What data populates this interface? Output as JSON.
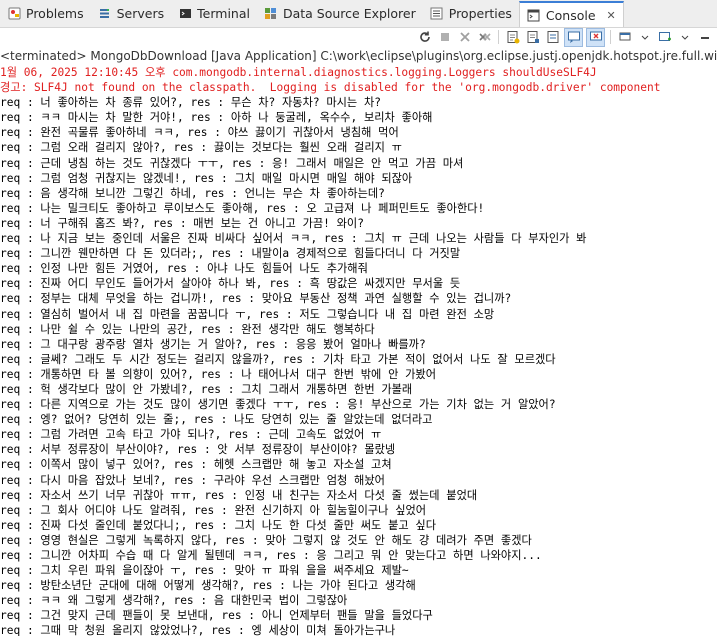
{
  "tabs": [
    {
      "label": "Problems",
      "icon": "problems-icon",
      "active": false
    },
    {
      "label": "Servers",
      "icon": "servers-icon",
      "active": false
    },
    {
      "label": "Terminal",
      "icon": "terminal-icon",
      "active": false
    },
    {
      "label": "Data Source Explorer",
      "icon": "data-source-explorer-icon",
      "active": false
    },
    {
      "label": "Properties",
      "icon": "properties-icon",
      "active": false
    },
    {
      "label": "Console",
      "icon": "console-icon",
      "active": true,
      "close": "✕"
    }
  ],
  "launch_label": "<terminated> MongoDbDownload [Java Application] C:\\work\\eclipse\\plugins\\org.eclipse.justj.openjdk.hotspot.jre.full.win32.x86_64",
  "console_lines": [
    {
      "text": "1월 06, 2025 12:10:45 오후 com.mongodb.internal.diagnostics.logging.Loggers shouldUseSLF4J",
      "style": "err"
    },
    {
      "text": "경고: SLF4J not found on the classpath.  Logging is disabled for the 'org.mongodb.driver' component",
      "style": "err"
    },
    {
      "text": "req : 너 좋아하는 차 종류 있어?, res : 무슨 차? 자동차? 마시는 차?",
      "style": "out"
    },
    {
      "text": "req : ㅋㅋ 마시는 차 말한 거야!, res : 아하 나 둥굴레, 옥수수, 보리차 좋아해",
      "style": "out"
    },
    {
      "text": "req : 완전 곡물류 좋아하네 ㅋㅋ, res : 야쓰 끓이기 귀찮아서 냉침해 먹어",
      "style": "out"
    },
    {
      "text": "req : 그럼 오래 걸리지 않아?, res : 끓이는 것보다는 훨씬 오래 걸리지 ㅠ",
      "style": "out"
    },
    {
      "text": "req : 근데 냉침 하는 것도 귀찮겠다 ㅜㅜ, res : 응! 그래서 매일은 안 먹고 가끔 마셔",
      "style": "out"
    },
    {
      "text": "req : 그럼 엄청 귀찮지는 않겠네!, res : 그치 매일 마시면 매일 해야 되잖아",
      "style": "out"
    },
    {
      "text": "req : 음 생각해 보니깐 그렇긴 하네, res : 언니는 무슨 차 좋아하는데?",
      "style": "out"
    },
    {
      "text": "req : 나는 밀크티도 좋아하고 루이보스도 좋아해, res : 오 고급져 나 페퍼민트도 좋아한다!",
      "style": "out"
    },
    {
      "text": "req : 너 구해줘 홈즈 봐?, res : 매번 보는 건 아니고 가끔! 와이?",
      "style": "out"
    },
    {
      "text": "req : 나 지금 보는 중인데 서울은 진짜 비싸다 싶어서 ㅋㅋ, res : 그치 ㅠ 근데 나오는 사람들 다 부자인가 봐",
      "style": "out"
    },
    {
      "text": "req : 그니깐 웬만하면 다 돈 있더라;, res : 내말이a 경제적으로 힘들다더니 다 거짓말",
      "style": "out"
    },
    {
      "text": "req : 인정 나만 힘든 거였어, res : 아냐 나도 힘들어 나도 추가해줘",
      "style": "out"
    },
    {
      "text": "req : 진짜 어디 무인도 들어가서 살아야 하나 봐, res : 흑 땅값은 싸겠지만 무서울 듯",
      "style": "out"
    },
    {
      "text": "req : 정부는 대체 무엇을 하는 겁니까!, res : 맞아요 부동산 정책 과연 실행할 수 있는 겁니까?",
      "style": "out"
    },
    {
      "text": "req : 열심히 벌어서 내 집 마련을 꿈꿉니다 ㅜ, res : 저도 그렇습니다 내 집 마련 완전 소망",
      "style": "out"
    },
    {
      "text": "req : 나만 쉴 수 있는 나만의 공간, res : 완전 생각만 해도 행복하다",
      "style": "out"
    },
    {
      "text": "req : 그 대구랑 광주랑 열차 생기는 거 알아?, res : 응응 봤어 얼마나 빠를까?",
      "style": "out"
    },
    {
      "text": "req : 글쎄? 그래도 두 시간 정도는 걸리지 않을까?, res : 기차 타고 가본 적이 없어서 나도 잘 모르겠다",
      "style": "out"
    },
    {
      "text": "req : 개통하면 타 볼 의향이 있어?, res : 나 태어나서 대구 한번 밖에 안 가봤어",
      "style": "out"
    },
    {
      "text": "req : 헉 생각보다 많이 안 가봤네?, res : 그치 그래서 개통하면 한번 가볼래",
      "style": "out"
    },
    {
      "text": "req : 다른 지역으로 가는 것도 많이 생기면 좋겠다 ㅜㅜ, res : 응! 부산으로 가는 기차 없는 거 알았어?",
      "style": "out"
    },
    {
      "text": "req : 엥? 없어? 당연히 있는 줄;, res : 나도 당연히 있는 줄 알았는데 없더라고",
      "style": "out"
    },
    {
      "text": "req : 그럼 가려면 고속 타고 가야 되나?, res : 근데 고속도 없었어 ㅠ",
      "style": "out"
    },
    {
      "text": "req : 서부 정류장이 부산이야?, res : 앗 서부 정류장이 부산이야? 몰랐넹",
      "style": "out"
    },
    {
      "text": "req : 이쪽서 많이 넣구 있어?, res : 헤헷 스크랩만 해 놓고 자소설 고쳐",
      "style": "out"
    },
    {
      "text": "req : 다시 마음 잡았나 보네?, res : 구라야 우선 스크랩만 엄청 해놨어",
      "style": "out"
    },
    {
      "text": "req : 자소서 쓰기 너무 귀찮아 ㅠㅠ, res : 인정 내 친구는 자소서 다섯 줄 썼는데 붙었대",
      "style": "out"
    },
    {
      "text": "req : 그 회사 어디야 나도 알려줘, res : 완전 신기하지 아 힐눔힐이구나 싶었어",
      "style": "out"
    },
    {
      "text": "req : 진짜 다섯 줄인데 붙었다니;, res : 그치 나도 한 다섯 줄만 써도 붙고 싶다",
      "style": "out"
    },
    {
      "text": "req : 영영 현실은 그렇게 녹록하지 않다, res : 맞아 그렇지 않 것도 안 해도 걍 데려가 주면 좋겠다",
      "style": "out"
    },
    {
      "text": "req : 그니깐 어차피 수습 때 다 알게 될텐데 ㅋㅋ, res : 응 그리고 뭐 안 맞는다고 하면 나와야지...",
      "style": "out"
    },
    {
      "text": "req : 그치 우린 파워 을이잖아 ㅜ, res : 맞아 ㅠ 파워 을을 써주세요 제발~",
      "style": "out"
    },
    {
      "text": "req : 방탄소년단 군대에 대해 어떻게 생각해?, res : 나는 가야 된다고 생각해",
      "style": "out"
    },
    {
      "text": "req : ㅋㅋ 왜 그렇게 생각해?, res : 음 대한민국 법이 그렇잖아",
      "style": "out"
    },
    {
      "text": "req : 그건 맞지 근데 팬들이 못 보낸대, res : 아니 언제부터 팬들 말을 들었다구",
      "style": "out"
    },
    {
      "text": "req : 그때 막 청원 올리지 않았었나?, res : 엥 세상이 미쳐 돌아가는구나",
      "style": "out"
    }
  ]
}
